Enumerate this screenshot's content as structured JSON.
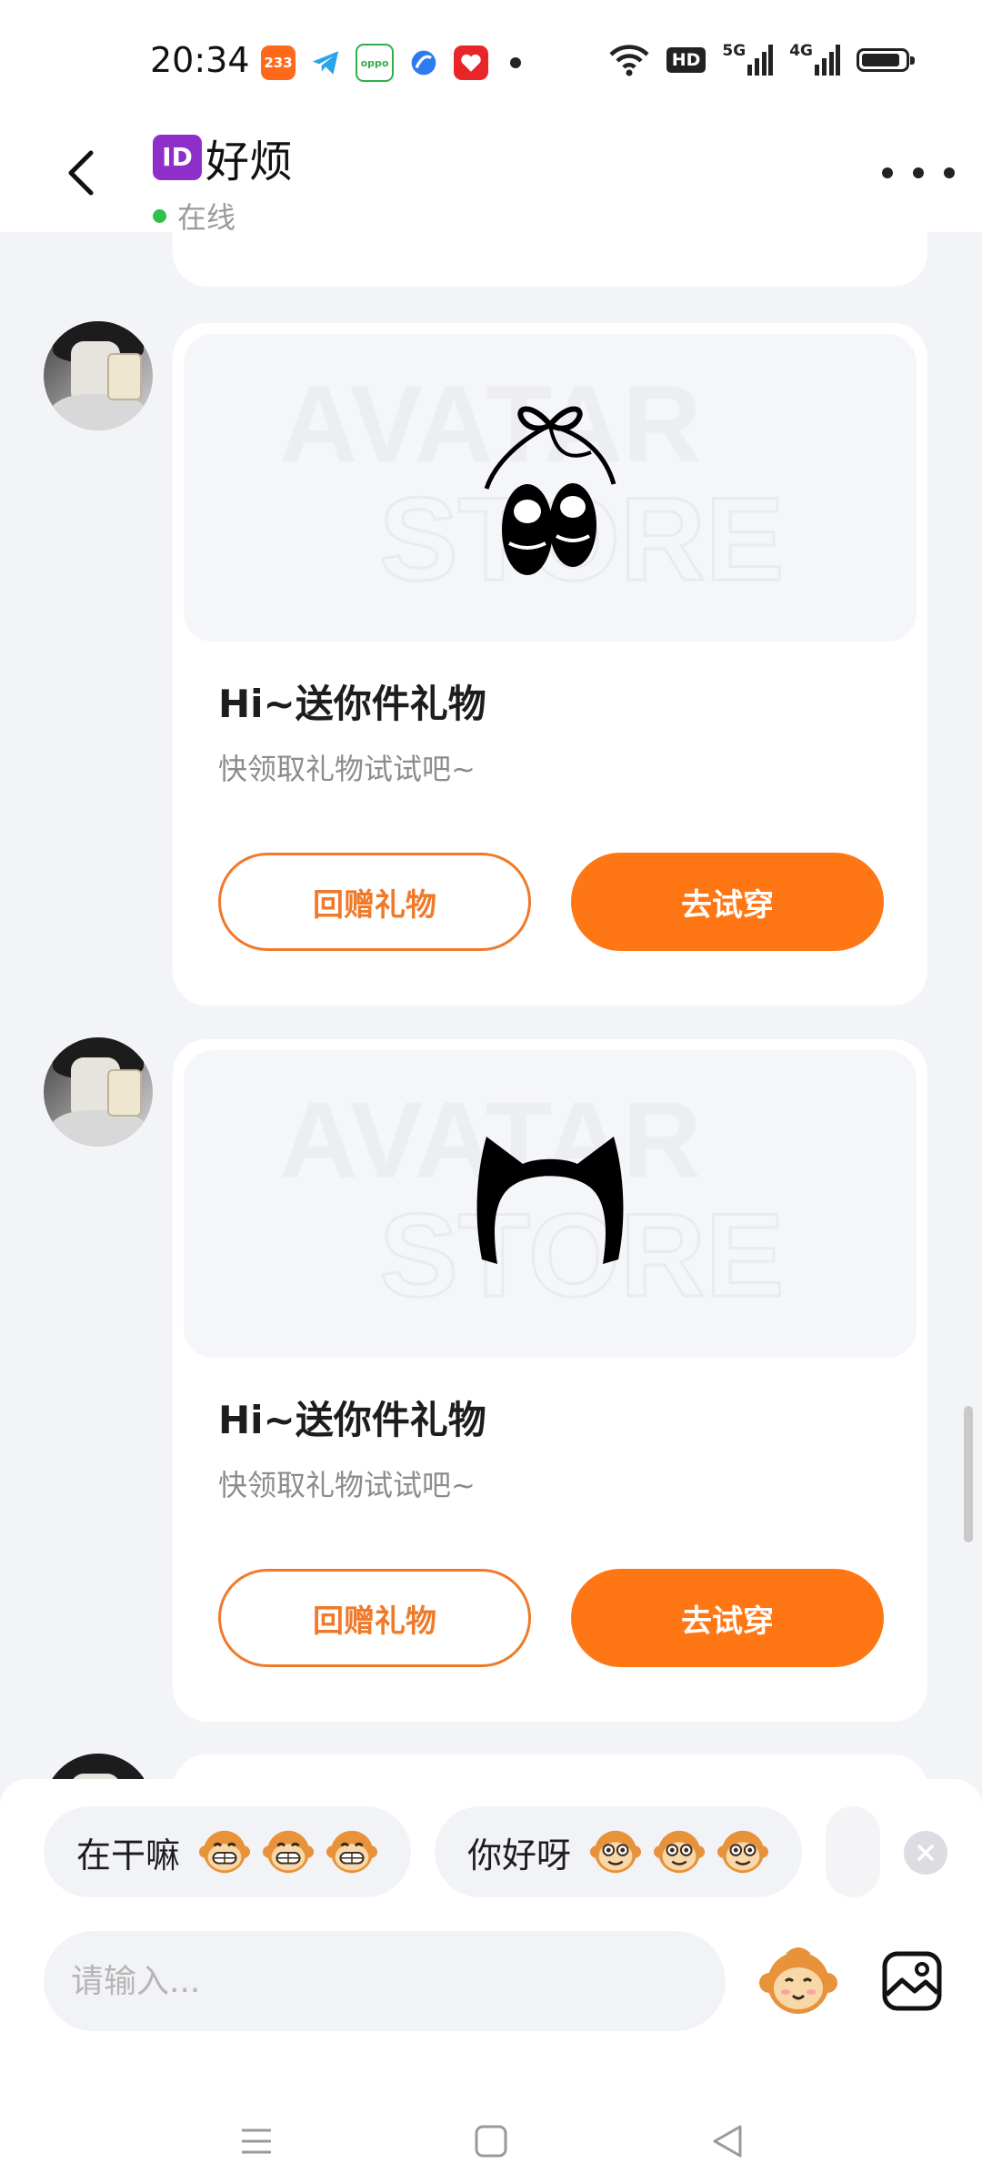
{
  "status_bar": {
    "time": "20:34",
    "apps": [
      {
        "icon": "233-app-icon",
        "label": "233",
        "color": "#ff6a1a"
      },
      {
        "icon": "telegram-icon",
        "label": "",
        "color": "#2aa3e8"
      },
      {
        "icon": "oppo-icon",
        "label": "oppo",
        "color": "#2fae4a"
      },
      {
        "icon": "browser-icon",
        "label": "",
        "color": "#2e7bf0"
      },
      {
        "icon": "heart-app-icon",
        "label": "",
        "color": "#e8262a"
      }
    ],
    "hd_label": "HD",
    "net_5g": "5G",
    "net_4g": "4G",
    "battery_level": 0.9
  },
  "header": {
    "back_icon": "chevron-left-icon",
    "id_badge": "ID",
    "title": "好烦",
    "status": "在线",
    "status_color": "#2ec24a",
    "more_icon": "more-horizontal-icon"
  },
  "messages": [
    {
      "type": "gift",
      "item_icon": "ballet-shoes-icon",
      "title": "Hi~送你件礼物",
      "subtitle": "快领取礼物试试吧~",
      "secondary_button": "回赠礼物",
      "primary_button": "去试穿"
    },
    {
      "type": "gift",
      "item_icon": "cat-ear-headband-icon",
      "title": "Hi~送你件礼物",
      "subtitle": "快领取礼物试试吧~",
      "secondary_button": "回赠礼物",
      "primary_button": "去试穿"
    }
  ],
  "quick_replies": [
    {
      "text": "在干嘛",
      "emoji_icon": "grinning-monkey-icon"
    },
    {
      "text": "你好呀",
      "emoji_icon": "smiling-monkey-icon"
    }
  ],
  "input": {
    "placeholder": "请输入..."
  },
  "accent_color": "#ff7615"
}
